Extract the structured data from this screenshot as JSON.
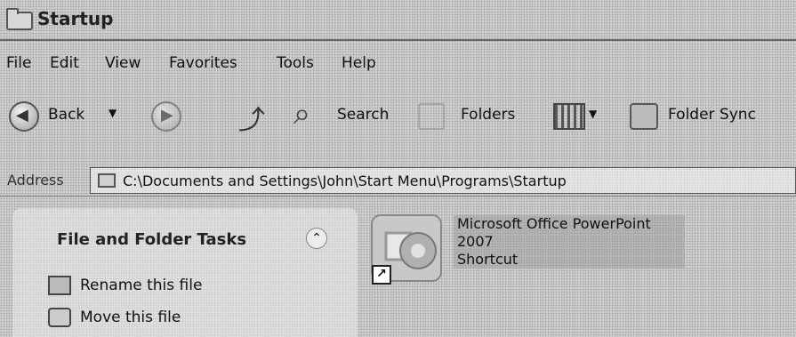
{
  "window": {
    "title": "Startup"
  },
  "menu": {
    "items": [
      "File",
      "Edit",
      "View",
      "Favorites",
      "Tools",
      "Help"
    ]
  },
  "toolbar": {
    "back_label": "Back",
    "search_label": "Search",
    "folders_label": "Folders",
    "sync_label": "Folder Sync"
  },
  "address": {
    "label": "Address",
    "path": "C:\\Documents and Settings\\John\\Start Menu\\Programs\\Startup"
  },
  "tasks": {
    "header": "File and Folder Tasks",
    "items": [
      "Rename this file",
      "Move this file"
    ]
  },
  "files": [
    {
      "name": "Microsoft Office PowerPoint 2007",
      "type": "Shortcut",
      "icon": "powerpoint-icon",
      "selected": true
    }
  ]
}
